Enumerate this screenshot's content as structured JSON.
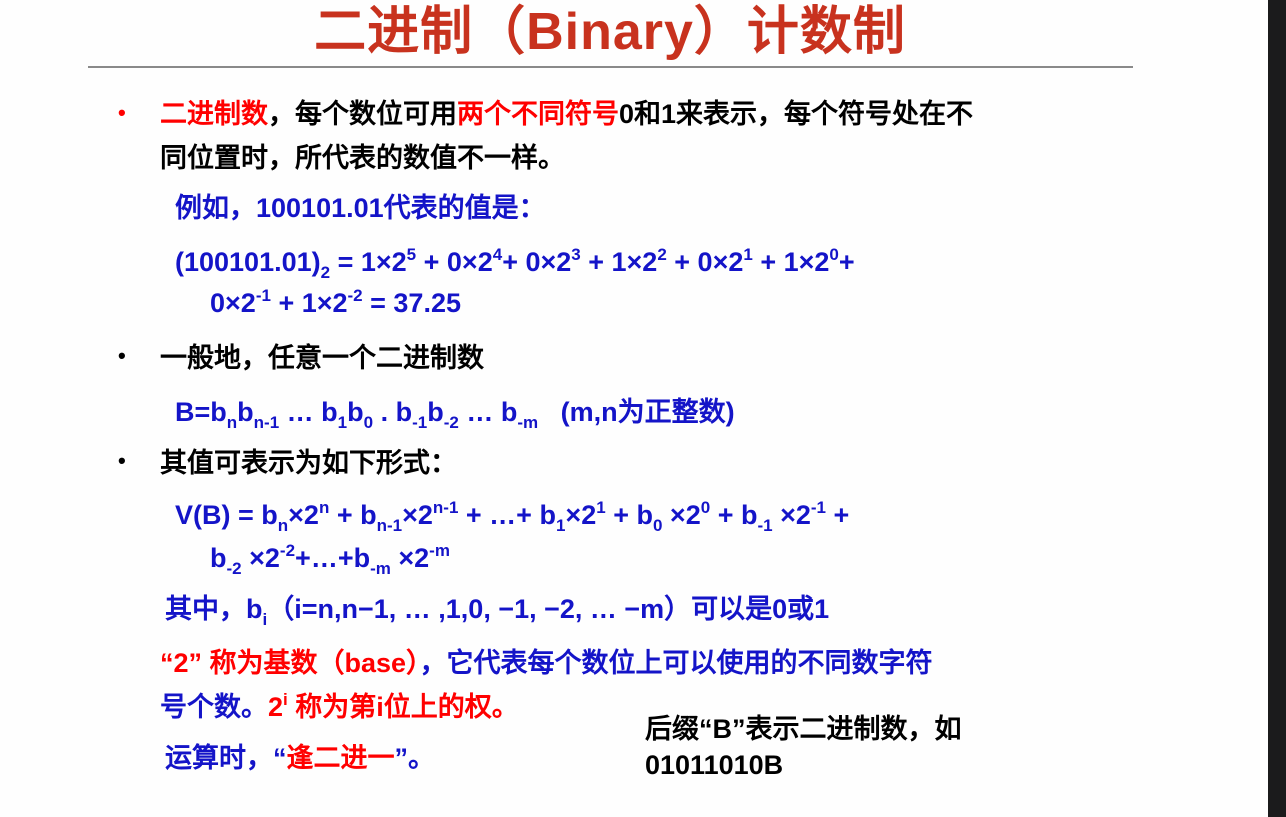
{
  "slide": {
    "title": "二进制（Binary）计数制",
    "colors": {
      "title": "#c8321e",
      "red": "#ff0000",
      "blue": "#1414c8",
      "black": "#000000"
    },
    "bullet_glyph": "•",
    "lines": [
      {
        "id": "bullet1-line1",
        "segs": [
          {
            "t": "二进制数",
            "c": "r"
          },
          {
            "t": "，每个数位可用",
            "c": "k"
          },
          {
            "t": "两个不同符号",
            "c": "r"
          },
          {
            "t": "0和1来表示，每个符号处在不",
            "c": "k"
          }
        ]
      },
      {
        "id": "bullet1-line2",
        "segs": [
          {
            "t": "同位置时，所代表的数值不一样。",
            "c": "k"
          }
        ]
      },
      {
        "id": "example-intro",
        "segs": [
          {
            "t": "例如，100101.01代表的值是：",
            "c": "b"
          }
        ]
      },
      {
        "id": "example-eq1",
        "segs": [
          {
            "t": "(100101.01)",
            "c": "b"
          },
          {
            "t": "2",
            "c": "b",
            "m": "sub"
          },
          {
            "t": " = 1×2",
            "c": "b"
          },
          {
            "t": "5",
            "c": "b",
            "m": "sup"
          },
          {
            "t": " + 0×2",
            "c": "b"
          },
          {
            "t": "4",
            "c": "b",
            "m": "sup"
          },
          {
            "t": "+ 0×2",
            "c": "b"
          },
          {
            "t": "3",
            "c": "b",
            "m": "sup"
          },
          {
            "t": " + 1×2",
            "c": "b"
          },
          {
            "t": "2",
            "c": "b",
            "m": "sup"
          },
          {
            "t": " + 0×2",
            "c": "b"
          },
          {
            "t": "1",
            "c": "b",
            "m": "sup"
          },
          {
            "t": " + 1×2",
            "c": "b"
          },
          {
            "t": "0",
            "c": "b",
            "m": "sup"
          },
          {
            "t": "+",
            "c": "b"
          }
        ]
      },
      {
        "id": "example-eq2",
        "segs": [
          {
            "t": "0×2",
            "c": "b"
          },
          {
            "t": "-1",
            "c": "b",
            "m": "sup"
          },
          {
            "t": " + 1×2",
            "c": "b"
          },
          {
            "t": "-2",
            "c": "b",
            "m": "sup"
          },
          {
            "t": " = 37.25",
            "c": "b"
          }
        ]
      },
      {
        "id": "bullet2",
        "segs": [
          {
            "t": "一般地，任意一个二进制数",
            "c": "k"
          }
        ]
      },
      {
        "id": "general-form",
        "segs": [
          {
            "t": "B=b",
            "c": "b"
          },
          {
            "t": "n",
            "c": "b",
            "m": "sub"
          },
          {
            "t": "b",
            "c": "b"
          },
          {
            "t": "n-1",
            "c": "b",
            "m": "sub"
          },
          {
            "t": " … b",
            "c": "b"
          },
          {
            "t": "1",
            "c": "b",
            "m": "sub"
          },
          {
            "t": "b",
            "c": "b"
          },
          {
            "t": "0",
            "c": "b",
            "m": "sub"
          },
          {
            "t": " . b",
            "c": "b"
          },
          {
            "t": "-1",
            "c": "b",
            "m": "sub"
          },
          {
            "t": "b",
            "c": "b"
          },
          {
            "t": "-2",
            "c": "b",
            "m": "sub"
          },
          {
            "t": " … b",
            "c": "b"
          },
          {
            "t": "-m",
            "c": "b",
            "m": "sub"
          },
          {
            "t": "   (m,n为正整数)",
            "c": "b"
          }
        ]
      },
      {
        "id": "bullet3",
        "segs": [
          {
            "t": "其值可表示为如下形式：",
            "c": "k"
          }
        ]
      },
      {
        "id": "value-eq1",
        "segs": [
          {
            "t": "V(B) = b",
            "c": "b"
          },
          {
            "t": "n",
            "c": "b",
            "m": "sub"
          },
          {
            "t": "×2",
            "c": "b"
          },
          {
            "t": "n",
            "c": "b",
            "m": "sup"
          },
          {
            "t": " + b",
            "c": "b"
          },
          {
            "t": "n-1",
            "c": "b",
            "m": "sub"
          },
          {
            "t": "×2",
            "c": "b"
          },
          {
            "t": "n-1",
            "c": "b",
            "m": "sup"
          },
          {
            "t": " + …+ b",
            "c": "b"
          },
          {
            "t": "1",
            "c": "b",
            "m": "sub"
          },
          {
            "t": "×2",
            "c": "b"
          },
          {
            "t": "1",
            "c": "b",
            "m": "sup"
          },
          {
            "t": " + b",
            "c": "b"
          },
          {
            "t": "0",
            "c": "b",
            "m": "sub"
          },
          {
            "t": " ×2",
            "c": "b"
          },
          {
            "t": "0",
            "c": "b",
            "m": "sup"
          },
          {
            "t": " + b",
            "c": "b"
          },
          {
            "t": "-1",
            "c": "b",
            "m": "sub"
          },
          {
            "t": " ×2",
            "c": "b"
          },
          {
            "t": "-1",
            "c": "b",
            "m": "sup"
          },
          {
            "t": " +",
            "c": "b"
          }
        ]
      },
      {
        "id": "value-eq2",
        "segs": [
          {
            "t": "b",
            "c": "b"
          },
          {
            "t": "-2",
            "c": "b",
            "m": "sub"
          },
          {
            "t": " ×2",
            "c": "b"
          },
          {
            "t": "-2",
            "c": "b",
            "m": "sup"
          },
          {
            "t": "+…+b",
            "c": "b"
          },
          {
            "t": "-m",
            "c": "b",
            "m": "sub"
          },
          {
            "t": " ×2",
            "c": "b"
          },
          {
            "t": "-m",
            "c": "b",
            "m": "sup"
          }
        ]
      },
      {
        "id": "where-line",
        "segs": [
          {
            "t": "其中，b",
            "c": "b"
          },
          {
            "t": "i",
            "c": "b",
            "m": "sub"
          },
          {
            "t": "（i=n,n−1, … ,1,0, −1, −2, … −m）可以是0或1",
            "c": "b"
          }
        ]
      },
      {
        "id": "base-line1",
        "segs": [
          {
            "t": "“2” 称为基数（base）",
            "c": "r"
          },
          {
            "t": "，它代表每个数位上可以使用的不同数字符",
            "c": "b"
          }
        ]
      },
      {
        "id": "base-line2",
        "segs": [
          {
            "t": "号个数。",
            "c": "b"
          },
          {
            "t": "2",
            "c": "r"
          },
          {
            "t": "i",
            "c": "r",
            "m": "sup"
          },
          {
            "t": " 称为第i位上的权。",
            "c": "r"
          }
        ]
      },
      {
        "id": "carry-rule",
        "segs": [
          {
            "t": "运算时，“",
            "c": "b"
          },
          {
            "t": "逢二进一",
            "c": "r"
          },
          {
            "t": "”。",
            "c": "b"
          }
        ]
      },
      {
        "id": "suffix-line1",
        "segs": [
          {
            "t": "后缀“B”表示二进制数，如",
            "c": "k"
          }
        ]
      },
      {
        "id": "suffix-line2",
        "segs": [
          {
            "t": "01011010B",
            "c": "k"
          }
        ]
      }
    ]
  }
}
